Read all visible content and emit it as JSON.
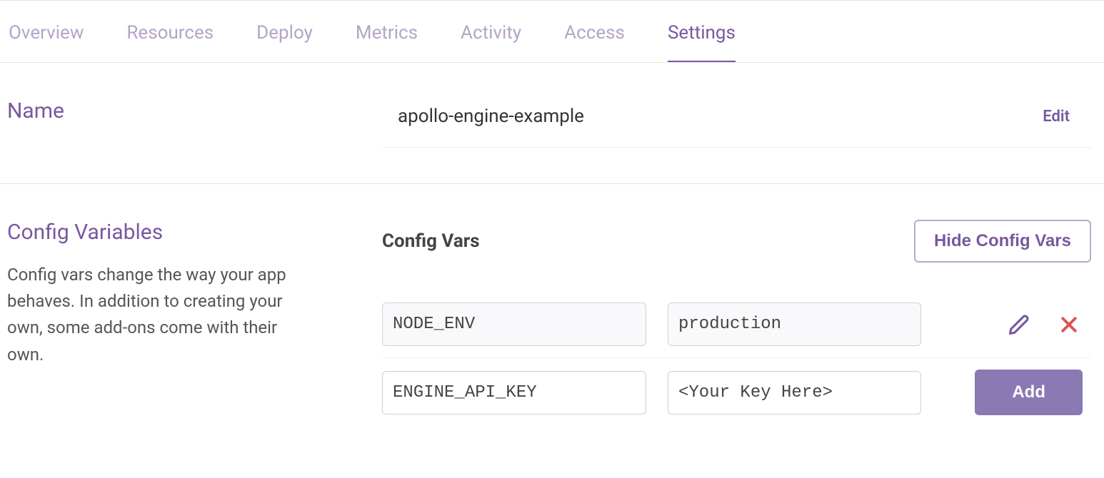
{
  "tabs": {
    "overview": "Overview",
    "resources": "Resources",
    "deploy": "Deploy",
    "metrics": "Metrics",
    "activity": "Activity",
    "access": "Access",
    "settings": "Settings"
  },
  "name_section": {
    "title": "Name",
    "value": "apollo-engine-example",
    "edit_label": "Edit"
  },
  "config_section": {
    "title": "Config Variables",
    "description": "Config vars change the way your app behaves. In addition to creating your own, some add-ons come with their own.",
    "header": "Config Vars",
    "hide_button": "Hide Config Vars",
    "rows": [
      {
        "key": "NODE_ENV",
        "value": "production"
      }
    ],
    "new_row": {
      "key": "ENGINE_API_KEY",
      "value": "<Your Key Here>"
    },
    "add_button": "Add"
  }
}
